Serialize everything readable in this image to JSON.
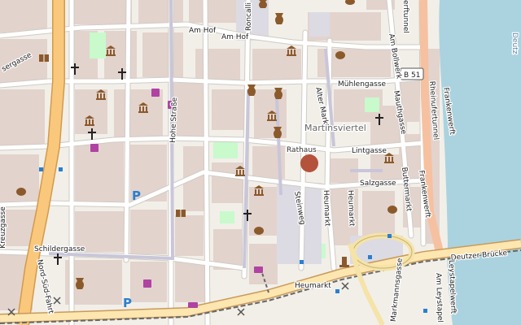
{
  "map": {
    "marker_color": "#b5523b",
    "colors": {
      "water": "#aad3df",
      "building_area": "#e8d6d3",
      "road": "#ffffff",
      "major_road": "#f7c983",
      "trunk_road": "#fcd6a4",
      "rail": "#888888",
      "pedestrian": "#dddde8",
      "park": "#c8facc"
    },
    "labels": {
      "am_hof_1": "Am Hof",
      "am_hof_2": "Am Hof",
      "roncalli": "Roncalli",
      "muehlengasse": "Mühlengasse",
      "am_bollwerk": "Am Bollwerk",
      "mauthgasse": "Mauthgasse",
      "alter_markt": "Alter Markt",
      "martinsviertel": "Martinsviertel",
      "rathaus": "Rathaus",
      "lintgasse": "Lintgasse",
      "salzgasse": "Salzgasse",
      "buttermarkt": "Buttermarkt",
      "heumarkt_v": "Heumarkt",
      "heumarkt_h": "Heumarkt",
      "steinweg": "Steinweg",
      "hohe_strasse": "Hohe Straße",
      "schildergasse": "Schildergasse",
      "kreuzgasse": "Kreuzgasse",
      "nord_sued_fahrt": "Nord-Süd-Fahrt",
      "markmannsgasse": "Markmannsgasse",
      "deutzer_bruecke": "Deutzer Brücke",
      "am_leystapel": "Am Leystapel",
      "leystapelwerft": "Leystapelwerft",
      "frankenwerft_1": "Frankenwerft",
      "frankenwerft_2": "Frankenwerft",
      "rheinufertunnel": "Rheinufertunnel",
      "rheinufertunnel_top": "erftunnel",
      "sergasse": "sergasse",
      "deutz": "Deutz",
      "b51": "B 51"
    }
  }
}
